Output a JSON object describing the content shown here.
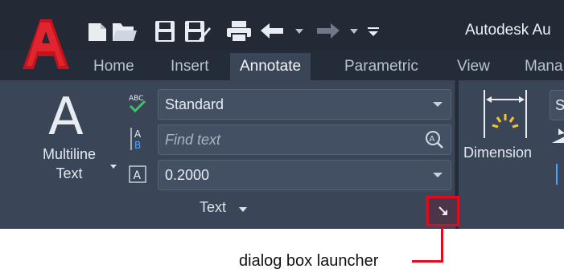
{
  "window": {
    "title": "Autodesk Au"
  },
  "quick_access": [
    {
      "icon": "new-file-icon"
    },
    {
      "icon": "open-folder-icon"
    },
    {
      "icon": "save-icon"
    },
    {
      "icon": "save-as-icon"
    },
    {
      "icon": "print-icon"
    },
    {
      "icon": "undo-icon"
    },
    {
      "icon": "redo-icon"
    },
    {
      "icon": "customize-toolbar-icon"
    }
  ],
  "tabs": [
    {
      "label": "Home",
      "active": false
    },
    {
      "label": "Insert",
      "active": false
    },
    {
      "label": "Annotate",
      "active": true
    },
    {
      "label": "Parametric",
      "active": false
    },
    {
      "label": "View",
      "active": false
    },
    {
      "label": "Mana",
      "active": false
    }
  ],
  "text_panel": {
    "big_glyph": "A",
    "multiline_label_line1": "Multiline",
    "multiline_label_line2": "Text",
    "style_value": "Standard",
    "find_placeholder": "Find text",
    "height_value": "0.2000",
    "title": "Text"
  },
  "dimension_panel": {
    "label": "Dimension",
    "style_value": "S"
  },
  "callout": {
    "label": "dialog box launcher"
  },
  "colors": {
    "accent_red": "#e00b1c",
    "ribbon_bg": "#3a4658",
    "titlebar_bg": "#232a36"
  }
}
